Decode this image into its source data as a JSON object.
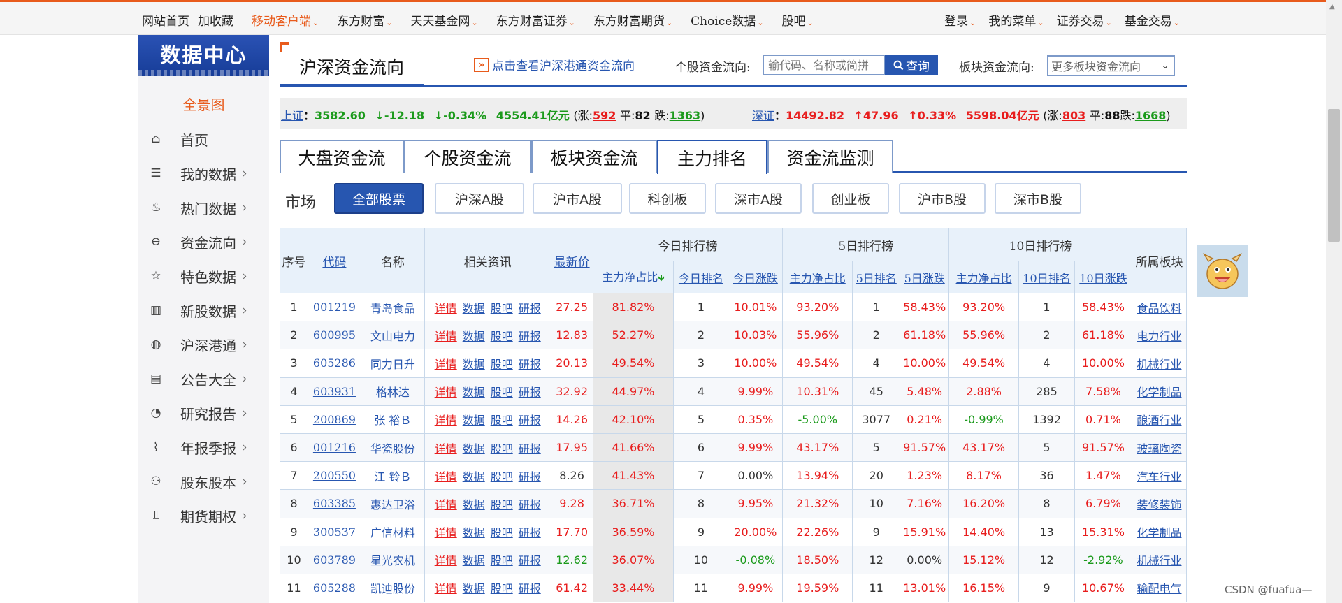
{
  "topnav": {
    "left": [
      "网站首页",
      "加收藏",
      "移动客户端",
      "东方财富",
      "天天基金网",
      "东方财富证券",
      "东方财富期货",
      "Choice数据",
      "股吧"
    ],
    "right": [
      "登录",
      "我的菜单",
      "证券交易",
      "基金交易"
    ]
  },
  "sidebar": {
    "logo": "数据中心",
    "overview": "全景图",
    "items": [
      {
        "label": "首页",
        "icon": "home-icon",
        "arrow": ""
      },
      {
        "label": "我的数据",
        "icon": "layers-icon",
        "arrow": "›"
      },
      {
        "label": "热门数据",
        "icon": "flame-icon",
        "arrow": "›"
      },
      {
        "label": "资金流向",
        "icon": "money-flow-icon",
        "arrow": "›"
      },
      {
        "label": "特色数据",
        "icon": "bookmark-star-icon",
        "arrow": "›"
      },
      {
        "label": "新股数据",
        "icon": "bar-chart-icon",
        "arrow": "›"
      },
      {
        "label": "沪深港通",
        "icon": "globe-icon",
        "arrow": "›"
      },
      {
        "label": "公告大全",
        "icon": "announcement-icon",
        "arrow": "›"
      },
      {
        "label": "研究报告",
        "icon": "pie-chart-icon",
        "arrow": "›"
      },
      {
        "label": "年报季报",
        "icon": "line-chart-icon",
        "arrow": "›"
      },
      {
        "label": "股东股本",
        "icon": "user-icon",
        "arrow": "›"
      },
      {
        "label": "期货期权",
        "icon": "futures-icon",
        "arrow": "›"
      }
    ]
  },
  "header": {
    "title": "沪深资金流向",
    "hk_link": "点击查看沪深港通资金流向",
    "stock_label": "个股资金流向:",
    "stock_placeholder": "输代码、名称或简拼",
    "query_label": "查询",
    "sector_label": "板块资金流向:",
    "sector_value": "更多板块资金流向"
  },
  "index": {
    "sh": {
      "name": "上证",
      "value": "3582.60",
      "change": "↓-12.18",
      "pct": "↓-0.34%",
      "amount": "4554.41亿元",
      "up_label": "(涨:",
      "up": "592",
      "flat_label": "平:",
      "flat": "82",
      "down_label": "跌:",
      "down": "1363",
      "close": ")"
    },
    "sz": {
      "name": "深证",
      "value": "14492.82",
      "change": "↑47.96",
      "pct": "↑0.33%",
      "amount": "5598.04亿元",
      "up_label": "(涨:",
      "up": "803",
      "flat_label": "平:",
      "flat": "88",
      "down_label": "跌:",
      "down": "1668",
      "close": ")"
    }
  },
  "tabs": [
    "大盘资金流",
    "个股资金流",
    "板块资金流",
    "主力排名",
    "资金流监测"
  ],
  "market": {
    "label": "市场",
    "buttons": [
      "全部股票",
      "沪深A股",
      "沪市A股",
      "科创板",
      "深市A股",
      "创业板",
      "沪市B股",
      "深市B股"
    ]
  },
  "table": {
    "headers": {
      "idx": "序号",
      "code": "代码",
      "name": "名称",
      "info": "相关资讯",
      "price": "最新价",
      "today": "今日排行榜",
      "d5": "5日排行榜",
      "d10": "10日排行榜",
      "sector": "所属板块"
    },
    "sub_headers": [
      "主力净占比",
      "今日排名",
      "今日涨跌",
      "主力净占比",
      "5日排名",
      "5日涨跌",
      "主力净占比",
      "10日排名",
      "10日涨跌"
    ],
    "sort_arrow": "🡻",
    "links": [
      "详情",
      "数据",
      "股吧",
      "研报"
    ],
    "rows": [
      [
        "1",
        "001219",
        "青岛食品",
        "27.25",
        "81.82%",
        "1",
        "10.01%",
        "93.20%",
        "1",
        "58.43%",
        "93.20%",
        "1",
        "58.43%",
        "食品饮料"
      ],
      [
        "2",
        "600995",
        "文山电力",
        "12.83",
        "52.27%",
        "2",
        "10.03%",
        "55.96%",
        "2",
        "61.18%",
        "55.96%",
        "2",
        "61.18%",
        "电力行业"
      ],
      [
        "3",
        "605286",
        "同力日升",
        "20.13",
        "49.54%",
        "3",
        "10.00%",
        "49.54%",
        "4",
        "10.00%",
        "49.54%",
        "4",
        "10.00%",
        "机械行业"
      ],
      [
        "4",
        "603931",
        "格林达",
        "32.92",
        "44.97%",
        "4",
        "9.99%",
        "10.31%",
        "45",
        "5.48%",
        "2.88%",
        "285",
        "7.58%",
        "化学制品"
      ],
      [
        "5",
        "200869",
        "张 裕Ｂ",
        "14.26",
        "42.10%",
        "5",
        "0.35%",
        "-5.00%",
        "3077",
        "0.21%",
        "-0.99%",
        "1392",
        "0.71%",
        "酿酒行业"
      ],
      [
        "6",
        "001216",
        "华瓷股份",
        "17.95",
        "41.66%",
        "6",
        "9.99%",
        "43.17%",
        "5",
        "91.57%",
        "43.17%",
        "5",
        "91.57%",
        "玻璃陶瓷"
      ],
      [
        "7",
        "200550",
        "江 铃Ｂ",
        "8.26",
        "41.43%",
        "7",
        "0.00%",
        "13.94%",
        "20",
        "1.23%",
        "8.17%",
        "36",
        "1.47%",
        "汽车行业"
      ],
      [
        "8",
        "603385",
        "惠达卫浴",
        "9.28",
        "36.71%",
        "8",
        "9.95%",
        "21.32%",
        "10",
        "7.16%",
        "16.20%",
        "8",
        "6.79%",
        "装修装饰"
      ],
      [
        "9",
        "300537",
        "广信材料",
        "17.70",
        "36.59%",
        "9",
        "20.00%",
        "22.26%",
        "9",
        "15.91%",
        "14.40%",
        "13",
        "15.31%",
        "化学制品"
      ],
      [
        "10",
        "603789",
        "星光农机",
        "12.62",
        "36.07%",
        "10",
        "-0.08%",
        "18.50%",
        "12",
        "0.00%",
        "15.12%",
        "12",
        "-2.92%",
        "机械行业"
      ],
      [
        "11",
        "605288",
        "凯迪股份",
        "61.42",
        "33.44%",
        "11",
        "9.99%",
        "19.59%",
        "11",
        "13.01%",
        "16.15%",
        "9",
        "10.67%",
        "输配电气"
      ]
    ]
  },
  "watermark": "CSDN @fuafua—",
  "colors": {
    "accent": "#e85b1c",
    "brand_blue": "#2756b0",
    "up": "#e81d1d",
    "down": "#1b9a1b"
  }
}
